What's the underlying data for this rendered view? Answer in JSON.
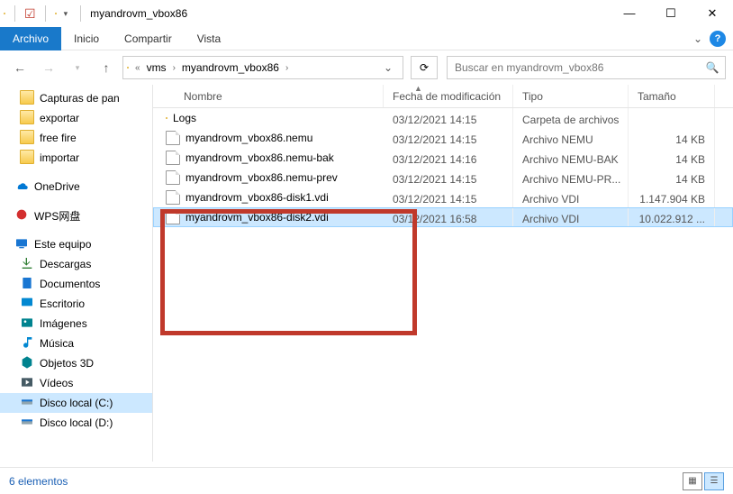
{
  "window": {
    "title": "myandrovm_vbox86"
  },
  "ribbon": {
    "tabs": {
      "file": "Archivo",
      "home": "Inicio",
      "share": "Compartir",
      "view": "Vista"
    }
  },
  "address": {
    "crumbs": [
      "vms",
      "myandrovm_vbox86"
    ]
  },
  "search": {
    "placeholder": "Buscar en myandrovm_vbox86"
  },
  "columns": {
    "name": "Nombre",
    "date": "Fecha de modificación",
    "type": "Tipo",
    "size": "Tamaño"
  },
  "tree": {
    "items": [
      {
        "label": "Capturas de pan",
        "icon": "folder",
        "depth": 2
      },
      {
        "label": "exportar",
        "icon": "folder",
        "depth": 2
      },
      {
        "label": "free fire",
        "icon": "folder",
        "depth": 2
      },
      {
        "label": "importar",
        "icon": "folder",
        "depth": 2
      },
      {
        "label": "spacer"
      },
      {
        "label": "OneDrive",
        "icon": "onedrive",
        "depth": 1
      },
      {
        "label": "spacer"
      },
      {
        "label": "WPS网盘",
        "icon": "wps",
        "depth": 1
      },
      {
        "label": "spacer"
      },
      {
        "label": "Este equipo",
        "icon": "pc",
        "depth": 1
      },
      {
        "label": "Descargas",
        "icon": "downloads",
        "depth": 2
      },
      {
        "label": "Documentos",
        "icon": "documents",
        "depth": 2
      },
      {
        "label": "Escritorio",
        "icon": "desktop",
        "depth": 2
      },
      {
        "label": "Imágenes",
        "icon": "pictures",
        "depth": 2
      },
      {
        "label": "Música",
        "icon": "music",
        "depth": 2
      },
      {
        "label": "Objetos 3D",
        "icon": "3d",
        "depth": 2
      },
      {
        "label": "Vídeos",
        "icon": "videos",
        "depth": 2
      },
      {
        "label": "Disco local (C:)",
        "icon": "drive",
        "depth": 2,
        "selected": true
      },
      {
        "label": "Disco local (D:)",
        "icon": "drive",
        "depth": 2
      }
    ]
  },
  "files": [
    {
      "name": "Logs",
      "date": "03/12/2021 14:15",
      "type": "Carpeta de archivos",
      "size": "",
      "icon": "folder"
    },
    {
      "name": "myandrovm_vbox86.nemu",
      "date": "03/12/2021 14:15",
      "type": "Archivo NEMU",
      "size": "14 KB",
      "icon": "file"
    },
    {
      "name": "myandrovm_vbox86.nemu-bak",
      "date": "03/12/2021 14:16",
      "type": "Archivo NEMU-BAK",
      "size": "14 KB",
      "icon": "file"
    },
    {
      "name": "myandrovm_vbox86.nemu-prev",
      "date": "03/12/2021 14:15",
      "type": "Archivo NEMU-PR...",
      "size": "14 KB",
      "icon": "file"
    },
    {
      "name": "myandrovm_vbox86-disk1.vdi",
      "date": "03/12/2021 14:15",
      "type": "Archivo VDI",
      "size": "1.147.904 KB",
      "icon": "file"
    },
    {
      "name": "myandrovm_vbox86-disk2.vdi",
      "date": "03/12/2021 16:58",
      "type": "Archivo VDI",
      "size": "10.022.912 ...",
      "icon": "file",
      "selected": true
    }
  ],
  "status": {
    "count": "6 elementos"
  }
}
